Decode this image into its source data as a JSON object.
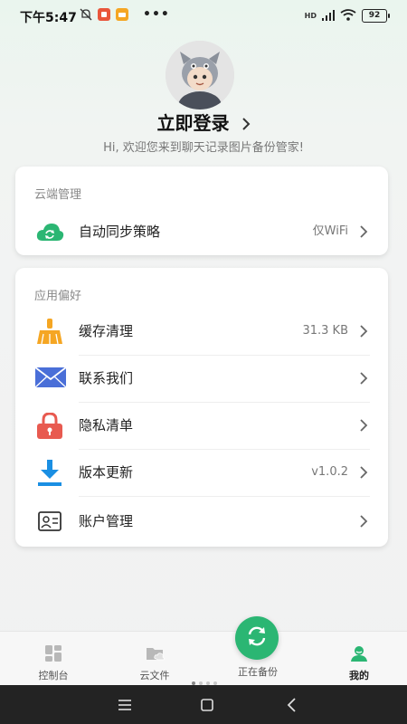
{
  "status_bar": {
    "time": "下午5:47",
    "network": "HD",
    "battery": "92"
  },
  "profile": {
    "login_label": "立即登录",
    "welcome_text": "Hi, 欢迎您来到聊天记录图片备份管家!"
  },
  "cloud_section": {
    "title": "云端管理",
    "items": [
      {
        "label": "自动同步策略",
        "value": "仅WiFi",
        "icon": "cloud-sync-icon"
      }
    ]
  },
  "prefs_section": {
    "title": "应用偏好",
    "items": [
      {
        "label": "缓存清理",
        "value": "31.3 KB",
        "icon": "broom-icon"
      },
      {
        "label": "联系我们",
        "value": "",
        "icon": "mail-icon"
      },
      {
        "label": "隐私清单",
        "value": "",
        "icon": "lock-icon"
      },
      {
        "label": "版本更新",
        "value": "v1.0.2",
        "icon": "download-icon"
      },
      {
        "label": "账户管理",
        "value": "",
        "icon": "id-card-icon"
      }
    ]
  },
  "bottom_nav": {
    "items": [
      {
        "label": "控制台",
        "icon": "dashboard-icon"
      },
      {
        "label": "云文件",
        "icon": "cloud-folder-icon"
      },
      {
        "label": "正在备份",
        "icon": "sync-icon"
      },
      {
        "label": "我的",
        "icon": "user-icon"
      }
    ],
    "active": "我的"
  },
  "colors": {
    "accent": "#2bb673",
    "cloud_icon": "#2bb673",
    "broom_icon": "#f5a623",
    "mail_icon": "#4a6fd8",
    "lock_icon": "#e85a50",
    "download_icon": "#1a8fe3"
  }
}
